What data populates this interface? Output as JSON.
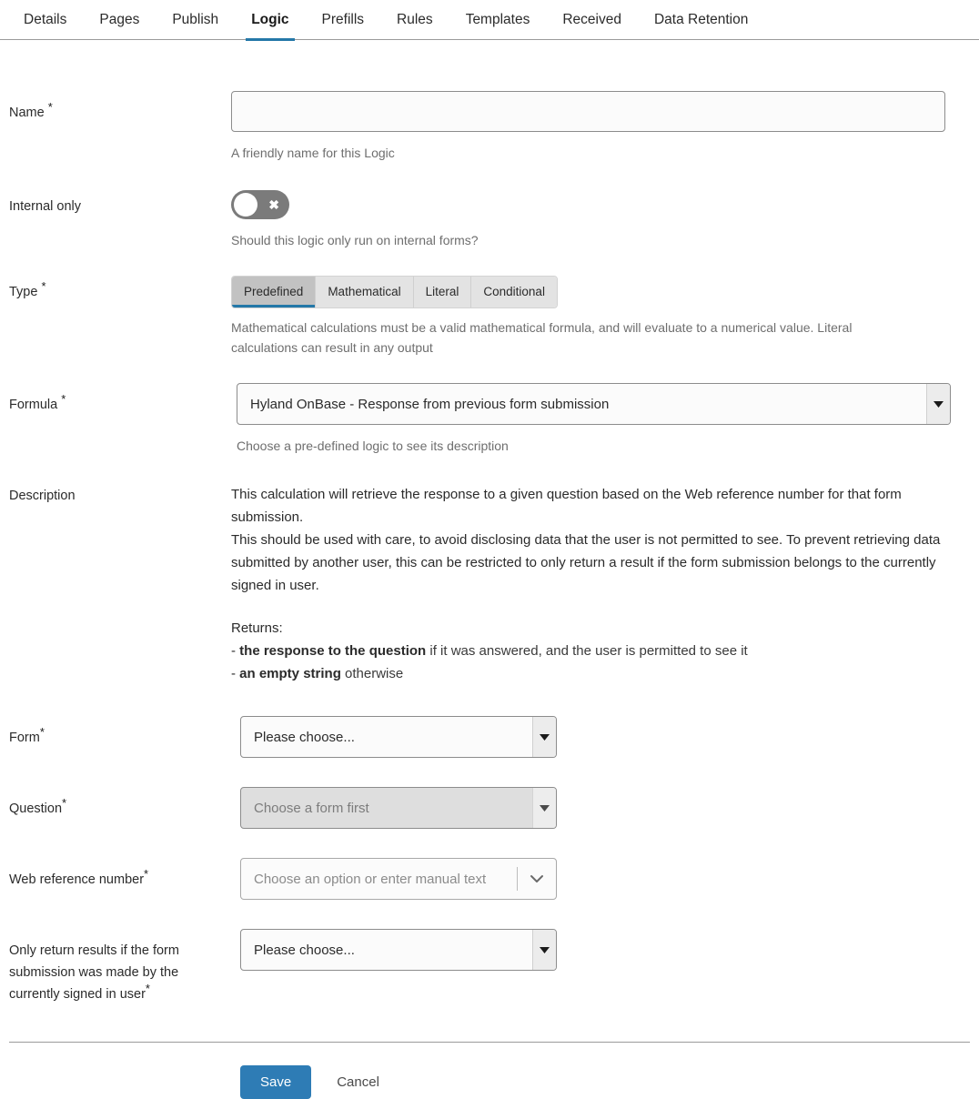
{
  "tabs": [
    {
      "label": "Details",
      "active": false
    },
    {
      "label": "Pages",
      "active": false
    },
    {
      "label": "Publish",
      "active": false
    },
    {
      "label": "Logic",
      "active": true
    },
    {
      "label": "Prefills",
      "active": false
    },
    {
      "label": "Rules",
      "active": false
    },
    {
      "label": "Templates",
      "active": false
    },
    {
      "label": "Received",
      "active": false
    },
    {
      "label": "Data Retention",
      "active": false
    }
  ],
  "fields": {
    "name": {
      "label": "Name",
      "required": "*",
      "value": "",
      "placeholder": "",
      "hint": "A friendly name for this Logic"
    },
    "internal_only": {
      "label": "Internal only",
      "state": "off",
      "icon": "cross-icon",
      "hint": "Should this logic only run on internal forms?"
    },
    "type": {
      "label": "Type",
      "required": "*",
      "options": [
        "Predefined",
        "Mathematical",
        "Literal",
        "Conditional"
      ],
      "selected": "Predefined",
      "hint": "Mathematical calculations must be a valid mathematical formula, and will evaluate to a numerical value. Literal calculations can result in any output"
    },
    "formula": {
      "label": "Formula",
      "required": "*",
      "value": "Hyland OnBase - Response from previous form submission",
      "hint": "Choose a pre-defined logic to see its description"
    },
    "description": {
      "label": "Description",
      "para1": "This calculation will retrieve the response to a given question based on the Web reference number for that form submission.",
      "para2": "This should be used with care, to avoid disclosing data that the user is not permitted to see. To prevent retrieving data submitted by another user, this can be restricted to only return a result if the form submission belongs to the currently signed in user.",
      "returns_label": "Returns:",
      "return_1_prefix": "- ",
      "return_1_bold": "the response to the question",
      "return_1_rest": " if it was answered, and the user is permitted to see it",
      "return_2_prefix": "- ",
      "return_2_bold": "an empty string",
      "return_2_rest": " otherwise"
    },
    "form": {
      "label": "Form",
      "required": "*",
      "value": "Please choose...",
      "disabled": false
    },
    "question": {
      "label": "Question",
      "required": "*",
      "value": "Choose a form first",
      "disabled": true
    },
    "web_reference_number": {
      "label": "Web reference number",
      "required": "*",
      "placeholder": "Choose an option or enter manual text",
      "value": ""
    },
    "only_return_results": {
      "label": "Only return results if the form submission was made by the currently signed in user",
      "required": "*",
      "value": "Please choose...",
      "disabled": false
    }
  },
  "footer": {
    "save_label": "Save",
    "cancel_label": "Cancel"
  },
  "colors": {
    "accent": "#2478a8",
    "save_button": "#2e7cb5",
    "toggle_off": "#7b7b7b",
    "segment_selected": "#c2c2c2"
  }
}
